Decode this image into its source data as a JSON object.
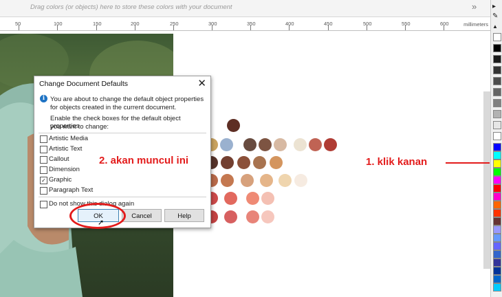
{
  "topbar": {
    "hint": "Drag colors (or objects) here to store these colors with your document",
    "more_arrows": "»"
  },
  "ruler": {
    "labels": [
      "50",
      "100",
      "150",
      "200",
      "250",
      "300",
      "350",
      "400",
      "450",
      "500",
      "550",
      "600"
    ],
    "units": "millimeters"
  },
  "dialog": {
    "title": "Change Document Defaults",
    "close_glyph": "✕",
    "info_line1": "You are about to change the default object properties",
    "info_line2": "for objects created in the current document.",
    "info_line3": "Enable the check boxes for the default object properties",
    "info_line4": "you want to change:",
    "options": [
      {
        "label": "Artistic Media",
        "checked": false
      },
      {
        "label": "Artistic Text",
        "checked": false
      },
      {
        "label": "Callout",
        "checked": false
      },
      {
        "label": "Dimension",
        "checked": false
      },
      {
        "label": "Graphic",
        "checked": true
      },
      {
        "label": "Paragraph Text",
        "checked": false
      }
    ],
    "dont_show": "Do not show this dialog again",
    "ok": "OK",
    "cancel": "Cancel",
    "help": "Help"
  },
  "annotations": {
    "step1": "1. klik kanan",
    "step2": "2. akan muncul ini"
  },
  "colors": {
    "accent_red": "#e31b1b",
    "palette": [
      "#ffffff",
      "#000000",
      "#1a1a1a",
      "#333333",
      "#4d4d4d",
      "#666666",
      "#808080",
      "#999999",
      "#b3b3b3",
      "#cccccc",
      "#e6e6e6",
      "#ffffff",
      "#0000ff",
      "#00ffff",
      "#00ff00",
      "#ffff00",
      "#ff0000",
      "#ff00ff",
      "#9900ff",
      "#ff6600",
      "#ff3300",
      "#993300",
      "#663333",
      "#9999ff",
      "#6666ff",
      "#6699ff",
      "#3366cc",
      "#333399",
      "#003399",
      "#0066cc"
    ],
    "swatch_rows": [
      [
        "#5e2e24"
      ],
      [
        "#c9a25f",
        "#9ab1cf",
        "#684b3f",
        "#7d5442",
        "#d7b9a2",
        "#ece3d2",
        "#c06354",
        "#b03c34"
      ],
      [
        "#56332a",
        "#733f30",
        "#8b5039",
        "#a8734f",
        "#d4955e",
        "#e9a977"
      ],
      [
        "#b86a4a",
        "#c47850",
        "#d7a17c",
        "#e5b589",
        "#efd5ae",
        "#f2dfc6",
        "#f6ebe1"
      ],
      [
        "#cc4a4a",
        "#e2695e",
        "#ef8a75",
        "#f3a798",
        "#f4c0b3"
      ],
      [
        "#c34242",
        "#d76060",
        "#e88479",
        "#f2a89a",
        "#f6c7bd"
      ]
    ]
  }
}
